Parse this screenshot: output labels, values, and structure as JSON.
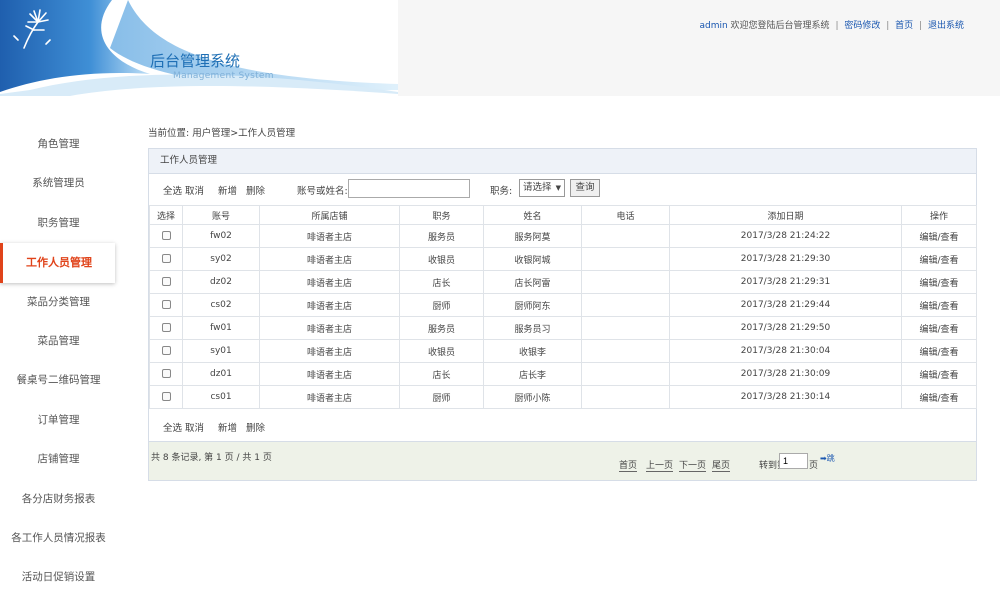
{
  "header": {
    "title": "后台管理系统",
    "subtitle": "Management System",
    "username": "admin",
    "welcome": " 欢迎您登陆后台管理系统",
    "links": [
      "密码修改",
      "首页",
      "退出系统"
    ],
    "separator": "|"
  },
  "sidebar": {
    "items": [
      {
        "label": "角色管理"
      },
      {
        "label": "系统管理员"
      },
      {
        "label": "职务管理"
      },
      {
        "label": "工作人员管理"
      },
      {
        "label": "菜品分类管理"
      },
      {
        "label": "菜品管理"
      },
      {
        "label": "餐桌号二维码管理"
      },
      {
        "label": "订单管理"
      },
      {
        "label": "店铺管理"
      },
      {
        "label": "各分店财务报表"
      },
      {
        "label": "各工作人员情况报表"
      },
      {
        "label": "活动日促销设置"
      }
    ],
    "active_index": 3
  },
  "breadcrumb": "当前位置: 用户管理>工作人员管理",
  "panel": {
    "title": "工作人员管理",
    "toolbar": {
      "select_all": "全选",
      "cancel": "取消",
      "add": "新增",
      "delete": "删除",
      "search_label": "账号或姓名:",
      "search_value": "",
      "position_label": "职务:",
      "position_selected": "请选择",
      "query": "查询"
    },
    "columns": [
      "选择",
      "账号",
      "所属店铺",
      "职务",
      "姓名",
      "电话",
      "添加日期",
      "操作"
    ],
    "rows": [
      {
        "account": "fw02",
        "store": "啡语者主店",
        "position": "服务员",
        "name": "服务阿莫",
        "phone": "",
        "date": "2017/3/28 21:24:22",
        "action": "编辑/查看"
      },
      {
        "account": "sy02",
        "store": "啡语者主店",
        "position": "收银员",
        "name": "收银阿城",
        "phone": "",
        "date": "2017/3/28 21:29:30",
        "action": "编辑/查看"
      },
      {
        "account": "dz02",
        "store": "啡语者主店",
        "position": "店长",
        "name": "店长阿雷",
        "phone": "",
        "date": "2017/3/28 21:29:31",
        "action": "编辑/查看"
      },
      {
        "account": "cs02",
        "store": "啡语者主店",
        "position": "厨师",
        "name": "厨师阿东",
        "phone": "",
        "date": "2017/3/28 21:29:44",
        "action": "编辑/查看"
      },
      {
        "account": "fw01",
        "store": "啡语者主店",
        "position": "服务员",
        "name": "服务员习",
        "phone": "",
        "date": "2017/3/28 21:29:50",
        "action": "编辑/查看"
      },
      {
        "account": "sy01",
        "store": "啡语者主店",
        "position": "收银员",
        "name": "收银李",
        "phone": "",
        "date": "2017/3/28 21:30:04",
        "action": "编辑/查看"
      },
      {
        "account": "dz01",
        "store": "啡语者主店",
        "position": "店长",
        "name": "店长李",
        "phone": "",
        "date": "2017/3/28 21:30:09",
        "action": "编辑/查看"
      },
      {
        "account": "cs01",
        "store": "啡语者主店",
        "position": "厨师",
        "name": "厨师小陈",
        "phone": "",
        "date": "2017/3/28 21:30:14",
        "action": "编辑/查看"
      }
    ],
    "bottom": {
      "select_all": "全选",
      "cancel": "取消",
      "add": "新增",
      "delete": "删除"
    },
    "pager": {
      "summary": "共 8 条记录, 第 1 页 / 共 1 页",
      "first": "首页",
      "prev": "上一页",
      "next": "下一页",
      "last": "尾页",
      "jump_label": "转到第",
      "page_value": "1",
      "jump_suffix": "页",
      "go": "➡跳"
    }
  },
  "colors": {
    "accent": "#e0431a",
    "link": "#1a57b0",
    "brand": "#1e6fb5"
  }
}
